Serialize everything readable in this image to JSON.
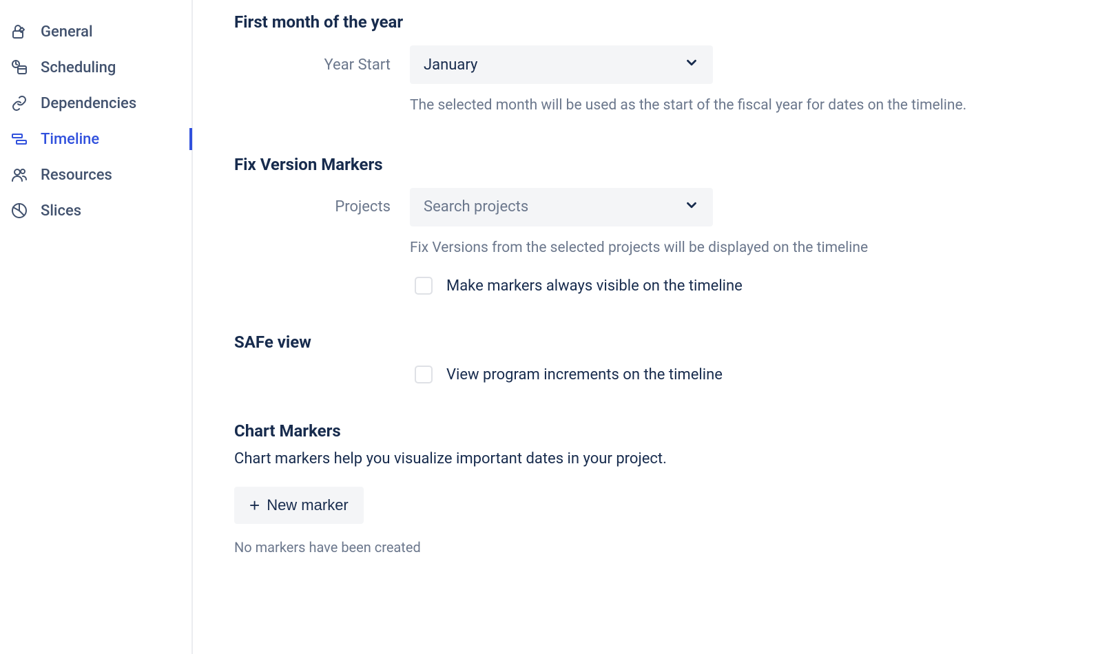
{
  "sidebar": {
    "items": [
      {
        "label": "General"
      },
      {
        "label": "Scheduling"
      },
      {
        "label": "Dependencies"
      },
      {
        "label": "Timeline"
      },
      {
        "label": "Resources"
      },
      {
        "label": "Slices"
      }
    ]
  },
  "sections": {
    "firstMonth": {
      "title": "First month of the year",
      "label": "Year Start",
      "value": "January",
      "helper": "The selected month will be used as the start of the fiscal year for dates on the timeline."
    },
    "fixVersion": {
      "title": "Fix Version Markers",
      "label": "Projects",
      "placeholder": "Search projects",
      "helper": "Fix Versions from the selected projects will be displayed on the timeline",
      "checkboxLabel": "Make markers always visible on the timeline"
    },
    "safe": {
      "title": "SAFe view",
      "checkboxLabel": "View program increments on the timeline"
    },
    "chartMarkers": {
      "title": "Chart Markers",
      "desc": "Chart markers help you visualize important dates in your project.",
      "buttonLabel": "New marker",
      "empty": "No markers have been created"
    }
  }
}
